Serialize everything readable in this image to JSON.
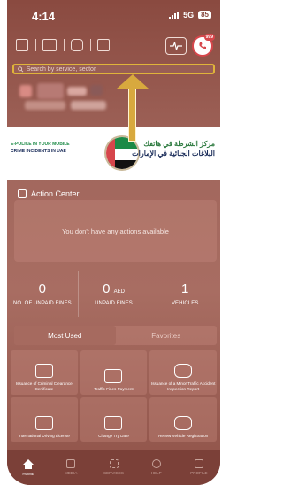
{
  "status_bar": {
    "time": "4:14",
    "network": "5G",
    "battery": "85"
  },
  "search": {
    "placeholder": "Search by service, sector"
  },
  "call_badge": "999",
  "banner": {
    "english_line1": "E-POLICE IN YOUR MOBILE",
    "english_line2": "CRIME INCIDENTS IN UAE",
    "arabic_line1": "مركز الشرطة في هاتفك",
    "arabic_line2": "البلاغات الجنائية في الإمارات"
  },
  "action_center": {
    "title": "Action Center",
    "empty_message": "You don't have any actions available"
  },
  "stats": [
    {
      "value": "0",
      "unit": "",
      "label": "NO. OF UNPAID FINES"
    },
    {
      "value": "0",
      "unit": "AED",
      "label": "UNPAID FINES"
    },
    {
      "value": "1",
      "unit": "",
      "label": "VEHICLES"
    }
  ],
  "tabs": [
    {
      "label": "Most Used",
      "active": true
    },
    {
      "label": "Favorites",
      "active": false
    }
  ],
  "services": [
    {
      "label": "Issuance of Criminal Clearance Certificate",
      "icon": "certificate-icon"
    },
    {
      "label": "Traffic Fines Payment",
      "icon": "payment-icon"
    },
    {
      "label": "Issuance of a Minor Traffic Accident Inspection Report",
      "icon": "car-accident-icon"
    },
    {
      "label": "International Driving License",
      "icon": "license-card-icon"
    },
    {
      "label": "Change Try Date",
      "icon": "calendar-car-icon"
    },
    {
      "label": "Renew Vehicle Registration",
      "icon": "vehicle-renew-icon"
    }
  ],
  "nav": [
    {
      "label": "HOME",
      "icon": "home-icon",
      "active": true
    },
    {
      "label": "MEDIA",
      "icon": "media-icon",
      "active": false
    },
    {
      "label": "SERVICES",
      "icon": "services-grid-icon",
      "active": false
    },
    {
      "label": "HELP",
      "icon": "help-icon",
      "active": false
    },
    {
      "label": "PROFILE",
      "icon": "profile-icon",
      "active": false
    }
  ],
  "colors": {
    "background": "#a2675d",
    "search_highlight": "#e0b43a",
    "arrow": "#d8a93e",
    "nav_bg": "#7b4038"
  }
}
